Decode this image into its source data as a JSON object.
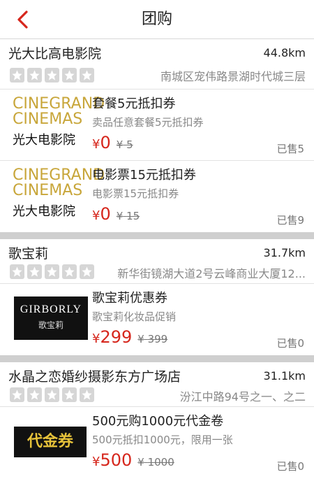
{
  "header": {
    "title": "团购"
  },
  "shops": [
    {
      "name": "光大比高电影院",
      "distance": "44.8km",
      "address": "南城区宠伟路景湖时代城三层",
      "deals": [
        {
          "logo_line1": "CINEGRAND",
          "logo_line2": "CINEMAS",
          "logo_caption": "光大电影院",
          "title": "套餐5元抵扣券",
          "subtitle": "卖品任意套餐5元抵扣券",
          "price": "0",
          "original": "5",
          "sold": "已售5"
        },
        {
          "logo_line1": "CINEGRAND",
          "logo_line2": "CINEMAS",
          "logo_caption": "光大电影院",
          "title": "电影票15元抵扣券",
          "subtitle": "电影票15元抵扣券",
          "price": "0",
          "original": "15",
          "sold": "已售9"
        }
      ]
    },
    {
      "name": "歌宝莉",
      "distance": "31.7km",
      "address": "新华街镜湖大道2号云峰商业大厦12...",
      "deals": [
        {
          "logo_line1": "GIRBORLY",
          "logo_line2": "歌宝莉",
          "title": "歌宝莉优惠券",
          "subtitle": "歌宝莉化妆品促销",
          "price": "299",
          "original": "399",
          "sold": "已售0"
        }
      ]
    },
    {
      "name": "水晶之恋婚纱摄影东方广场店",
      "distance": "31.1km",
      "address": "汾江中路94号之一、之二",
      "deals": [
        {
          "logo_line1": "代金券",
          "title": "500元购1000元代金卷",
          "subtitle": "500元抵扣1000元，限用一张",
          "price": "500",
          "original": "1000",
          "sold": "已售0"
        }
      ]
    }
  ],
  "currency_symbol": "¥",
  "colors": {
    "price": "#d6261c",
    "back_arrow": "#d6261c",
    "logo_gold": "#c8a63a"
  },
  "icons": {
    "back": "chevron-left-icon",
    "rating": "star-icon"
  }
}
